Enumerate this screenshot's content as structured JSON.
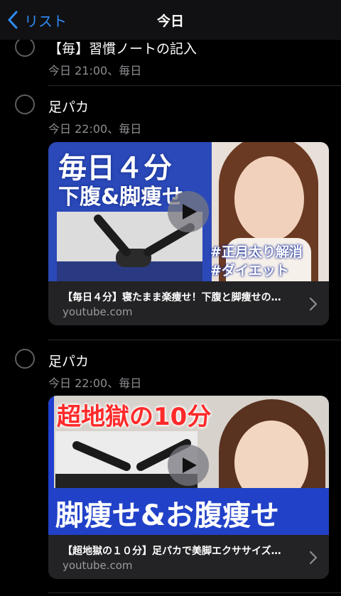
{
  "nav": {
    "back_label": "リスト",
    "title": "今日"
  },
  "items": [
    {
      "title": "【毎】習慣ノートの記入",
      "subtitle": "今日 21:00、毎日"
    },
    {
      "title": "足パカ",
      "subtitle": "今日 22:00、毎日",
      "card": {
        "title": "【毎日４分】寝たまま楽痩せ！下腹と脚痩せの…",
        "host": "youtube.com",
        "thumb_text": [
          "毎日４分",
          "下腹&脚痩せ",
          "#正月太り解消",
          "#ダイエット"
        ]
      }
    },
    {
      "title": "足パカ",
      "subtitle": "今日 22:00、毎日",
      "card": {
        "title": "【超地獄の１０分】足パカで美脚エクササイズ…",
        "host": "youtube.com",
        "thumb_text": [
          "超地獄の10分",
          "脚痩せ&お腹痩せ"
        ]
      }
    }
  ],
  "colors": {
    "accent": "#2f8cf7",
    "background": "#000000",
    "secondary_text": "#8e8e93",
    "card_bg": "#232325"
  },
  "icons": {
    "back": "chevron-left-icon",
    "play": "play-icon",
    "disclosure": "chevron-right-icon",
    "checkbox": "circle-icon"
  }
}
